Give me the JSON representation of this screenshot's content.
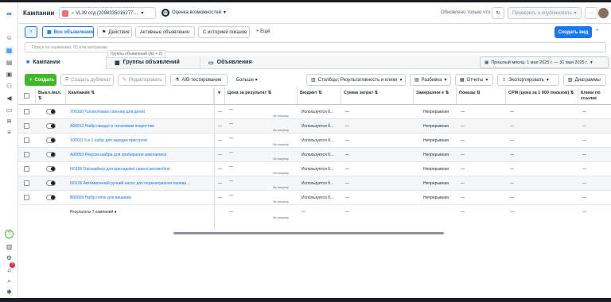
{
  "header": {
    "title": "Кампании",
    "account_name": "VL39 ссд (2098335016277…",
    "opportunity_score": "Оценка возможностей",
    "score_value": "100",
    "status_text": "Обновлено только что",
    "review_btn": "Проверить и опубликовать",
    "more_btn": "···"
  },
  "toolbar1": {
    "all_ads": "Все объявления",
    "actions": "Действия",
    "active_ads": "Активные объявления",
    "history": "С историей показов",
    "more": "Ещё",
    "create_view": "Создать вид"
  },
  "search": {
    "placeholder": "Поиск по названию, ID или метрикам"
  },
  "tooltip": "Группы объявлений (Alt + 2)",
  "tabs": {
    "campaigns": "Кампании",
    "adsets": "Группы объявлений",
    "ads": "Объявления",
    "date": "Прошлый месяц: 1 мая 2025 г. — 31 мая 2025 г."
  },
  "toolbar2": {
    "create": "Создать",
    "duplicate": "Создать дубликат",
    "edit": "Редактировать",
    "ab": "A/B-тестирование",
    "more": "Больше",
    "columns": "Столбцы: Результативность и клики",
    "breakdown": "Разбивка",
    "reports": "Отчеты",
    "export": "Экспортировать",
    "charts": "Диаграммы"
  },
  "columns": {
    "onoff": "Выкл./вкл.",
    "campaign": "Кампания",
    "cost_per_result": "Цена за результат",
    "budget": "Бюджет",
    "amount_spent": "Сумма затрат",
    "ends": "Завершени е",
    "impressions": "Показы",
    "cpm": "CPM (цена за 1 000 показов)",
    "link_clicks": "Клики по ссылке"
  },
  "rows": [
    {
      "name": "У00160 Головоломка спиннер для детей",
      "dash": "—",
      "per": "За покупку",
      "budget": "Используется б...",
      "ends": "Непрерывная"
    },
    {
      "name": "А00012 Набір свердл із титановим покриттям",
      "dash": "—",
      "per": "За покупку",
      "budget": "Используется б...",
      "ends": "Непрерывная"
    },
    {
      "name": "Х00011 5 в 1 набір для зарядки пристроїв",
      "dash": "—",
      "per": "За покупку",
      "budget": "Используется б...",
      "ends": "Непрерывная"
    },
    {
      "name": "А00053 Рекуска шабра для прибирання закінчилися",
      "dash": "—",
      "per": "За покупку",
      "budget": "Используется б...",
      "ends": "Непрерывная"
    },
    {
      "name": "І00156 Органайзер для приладової панелі автомобіля",
      "dash": "—",
      "per": "За покупку",
      "budget": "Используется б...",
      "ends": "Непрерывная"
    },
    {
      "name": "І00126 Автоматичний ручний насос для перекачування палива ...",
      "dash": "—",
      "per": "За покупку",
      "budget": "Используется б...",
      "ends": "Непрерывная"
    },
    {
      "name": "В00009 Набір голок для вишивки",
      "dash": "—",
      "per": "За покупку",
      "budget": "Используется б...",
      "ends": "Непрерывная"
    }
  ],
  "results": {
    "label": "Результаты 7 кампаний",
    "per": "За покупку"
  },
  "sidebar": {
    "badge": "3"
  }
}
